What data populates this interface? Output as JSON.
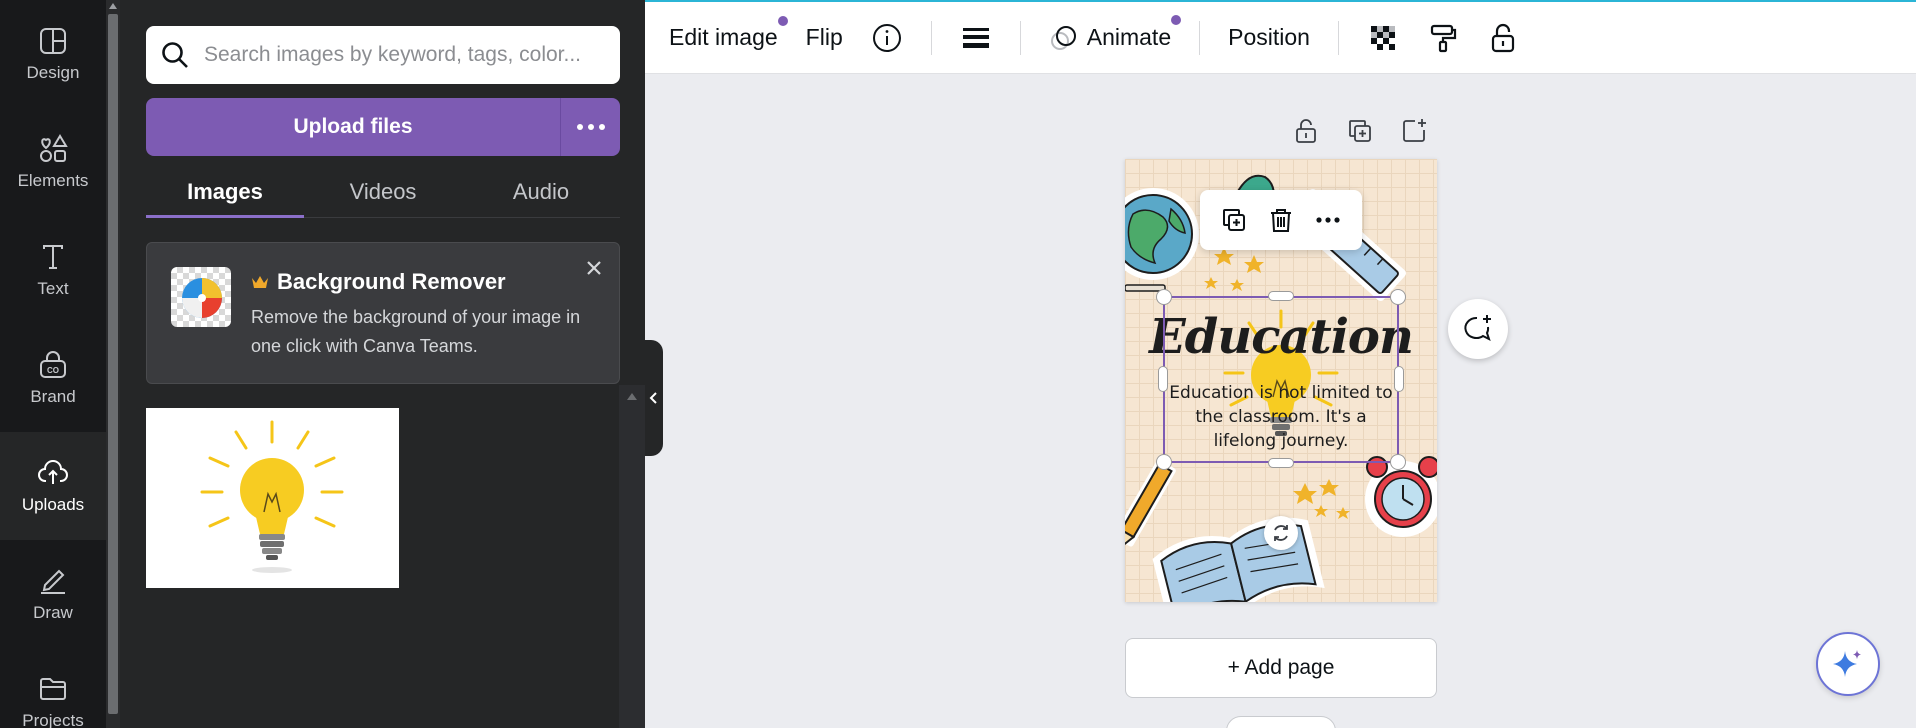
{
  "rail": {
    "items": [
      {
        "label": "Design",
        "icon": "design-icon"
      },
      {
        "label": "Elements",
        "icon": "elements-icon"
      },
      {
        "label": "Text",
        "icon": "text-icon"
      },
      {
        "label": "Brand",
        "icon": "brand-icon"
      },
      {
        "label": "Uploads",
        "icon": "uploads-icon",
        "active": true
      },
      {
        "label": "Draw",
        "icon": "draw-icon"
      },
      {
        "label": "Projects",
        "icon": "projects-icon"
      }
    ]
  },
  "panel": {
    "search": {
      "placeholder": "Search images by keyword, tags, color..."
    },
    "upload_label": "Upload files",
    "tabs": [
      {
        "label": "Images",
        "active": true
      },
      {
        "label": "Videos"
      },
      {
        "label": "Audio"
      }
    ],
    "promo": {
      "title": "Background Remover",
      "description": "Remove the background of your image in one click with Canva Teams."
    }
  },
  "toolbar": {
    "edit_image": "Edit image",
    "flip": "Flip",
    "animate": "Animate",
    "position": "Position"
  },
  "canvas": {
    "title": "Education",
    "body": "Education is not limited to the classroom. It's a lifelong journey.",
    "add_page": "+ Add page"
  },
  "colors": {
    "accent": "#7d5bb3",
    "rail_bg": "#18191b",
    "panel_bg": "#252627",
    "canvas_bg": "#ebecf0",
    "toolbar_top_border": "#2bb5d6"
  }
}
